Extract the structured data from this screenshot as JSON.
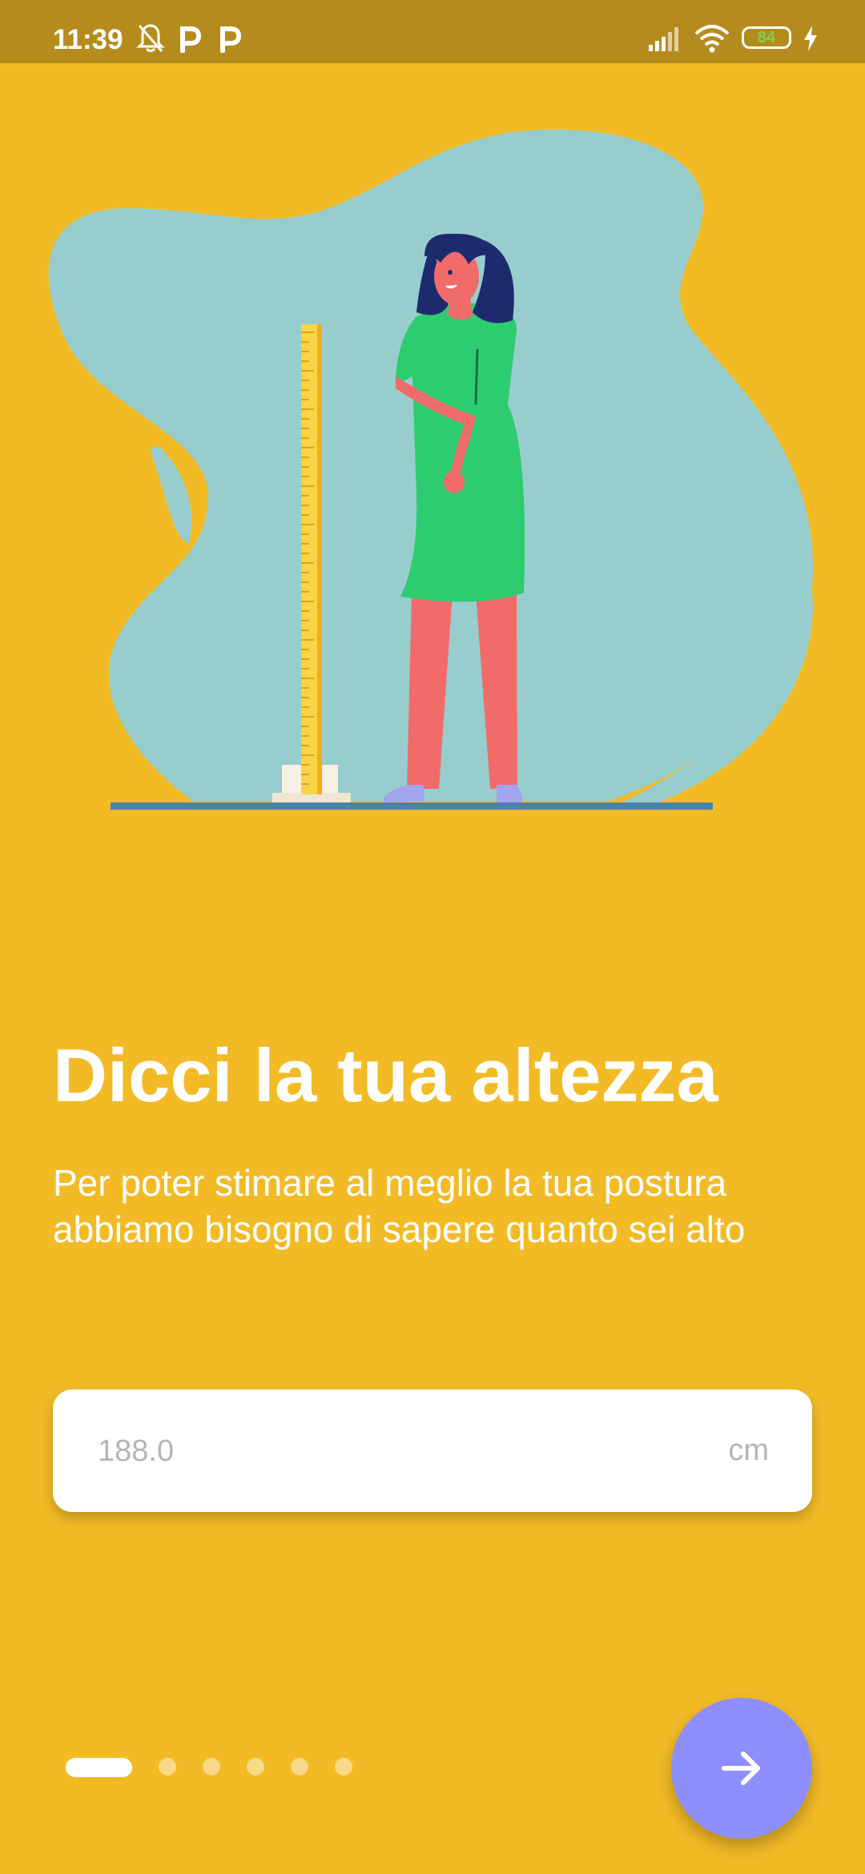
{
  "status_bar": {
    "time": "11:39",
    "battery_level": "84",
    "icons": [
      "bell-off-icon",
      "parking-icon",
      "parking-icon",
      "signal-icon",
      "wifi-icon",
      "battery-icon",
      "charging-icon"
    ]
  },
  "main": {
    "title": "Dicci la tua altezza",
    "subtitle": "Per poter stimare al meglio la tua postura abbiamo bisogno di sapere quanto sei alto"
  },
  "height_input": {
    "placeholder": "188.0",
    "value": "",
    "unit": "cm"
  },
  "pager": {
    "total": 6,
    "current": 1
  },
  "next_button": {
    "icon": "arrow-right-icon"
  },
  "colors": {
    "background": "#F2BB26",
    "status_bar": "#B68B1E",
    "accent": "#8E8EFF",
    "blob": "#98CDCD",
    "dress": "#2ECC71",
    "skin": "#F26B6B",
    "hair": "#1E2A6E"
  }
}
